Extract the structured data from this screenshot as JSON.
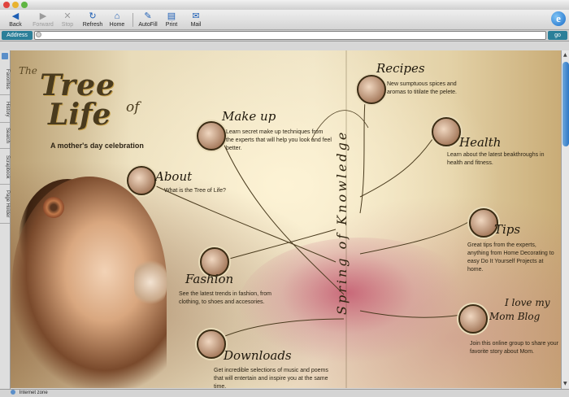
{
  "toolbar": {
    "back": "Back",
    "forward": "Forward",
    "stop": "Stop",
    "refresh": "Refresh",
    "home": "Home",
    "autofill": "AutoFill",
    "print": "Print",
    "mail": "Mail"
  },
  "address": {
    "label": "Address",
    "value": "",
    "go": "go"
  },
  "sidebar": {
    "tabs": [
      "Favorites",
      "History",
      "Search",
      "Scrapbook",
      "Page Holder"
    ]
  },
  "status": {
    "zone": "Internet zone"
  },
  "page": {
    "logo_small": "The",
    "logo_tree": "Tree",
    "logo_of": "of",
    "logo_life": "Life",
    "tagline": "A mother's day celebration",
    "vertical_title": "Spring of Knowledge",
    "sections": {
      "makeup": {
        "title": "Make up",
        "desc": "Learn secret make up techniques from the experts that will help you look and feel better."
      },
      "about": {
        "title": "About",
        "desc": "What is the Tree of Life?"
      },
      "fashion": {
        "title": "Fashion",
        "desc": "See the latest trends in fashion, from clothing, to shoes and accesories."
      },
      "downloads": {
        "title": "Downloads",
        "desc": "Get incredible selections of music and poems that will entertain and inspire you at the same time."
      },
      "recipes": {
        "title": "Recipes",
        "desc": "New sumptuous spices and aromas to titilate the pelete."
      },
      "health": {
        "title": "Health",
        "desc": "Learn about the latest beakthroughs in health and fitness."
      },
      "tips": {
        "title": "Tips",
        "desc": "Great tips from the experts, anything from Home Decorating to easy Do It Yourself Projects at home."
      },
      "blog": {
        "title_1": "I love my",
        "title_2": "Mom Blog",
        "desc": "Join this online group to share your favorite story about Mom."
      }
    }
  },
  "colors": {
    "accent": "#2b7f99",
    "paper": "#e9dcba",
    "ink": "#2c2415"
  }
}
